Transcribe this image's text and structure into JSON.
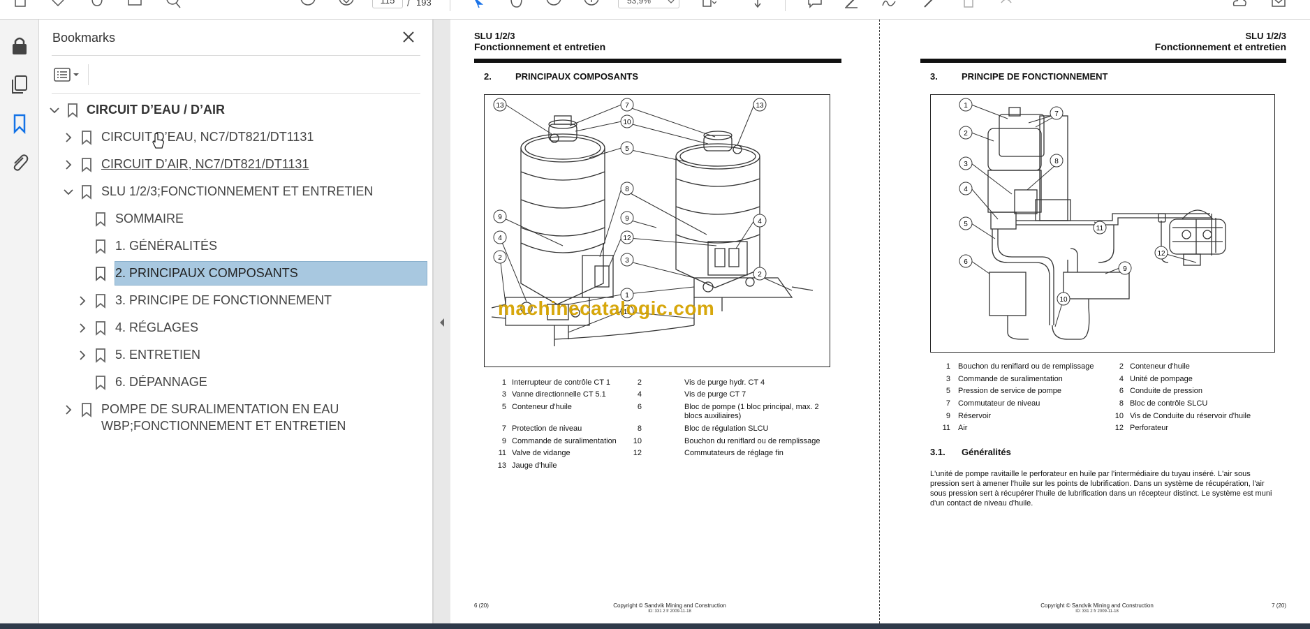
{
  "toolbar": {
    "page_current": "115",
    "page_separator": "/",
    "page_total": "193",
    "zoom": "53,9%",
    "icons": [
      "save-icon",
      "star-icon",
      "upload-icon",
      "print-icon",
      "search-icon",
      "page-up-icon",
      "page-down-icon",
      "select-arrow-icon",
      "hand-icon",
      "zoom-out-icon",
      "zoom-in-icon",
      "zoom-dropdown-icon",
      "fit-page-icon",
      "scroll-icon",
      "comment-icon",
      "highlight-icon",
      "sign-icon",
      "edit-icon",
      "delete-icon",
      "undo-icon",
      "cloud-icon",
      "mail-icon"
    ]
  },
  "rail": {
    "icons": [
      "lock-icon",
      "pages-icon",
      "bookmark-icon",
      "attachment-icon"
    ]
  },
  "bookmarks": {
    "title": "Bookmarks",
    "items": [
      {
        "label": "CIRCUIT D’EAU / D’AIR",
        "level": 0,
        "expanded": true
      },
      {
        "label": "CIRCUIT D’EAU, NC7/DT821/DT1131",
        "level": 1,
        "expanded": false
      },
      {
        "label": "CIRCUIT D’AIR, NC7/DT821/DT1131",
        "level": 1,
        "expanded": false
      },
      {
        "label": "SLU 1/2/3;FONCTIONNEMENT ET ENTRETIEN",
        "level": 1,
        "expanded": true
      },
      {
        "label": "SOMMAIRE",
        "level": 2
      },
      {
        "label": "1. GÉNÉRALITÉS",
        "level": 2
      },
      {
        "label": "2. PRINCIPAUX COMPOSANTS",
        "level": 2,
        "selected": true
      },
      {
        "label": "3. PRINCIPE DE FONCTIONNEMENT",
        "level": 2,
        "expanded": false
      },
      {
        "label": "4. RÉGLAGES",
        "level": 2,
        "expanded": false
      },
      {
        "label": "5. ENTRETIEN",
        "level": 2,
        "expanded": false
      },
      {
        "label": "6. DÉPANNAGE",
        "level": 2
      },
      {
        "label_line1": "POMPE DE SURALIMENTATION EN EAU",
        "label_line2": "WBP;FONCTIONNEMENT ET ENTRETIEN",
        "level": 1,
        "expanded": false
      }
    ]
  },
  "doc": {
    "left": {
      "code": "SLU 1/2/3",
      "title": "Fonctionnement et entretien",
      "section_num": "2.",
      "section_title": "PRINCIPAUX COMPOSANTS",
      "callouts": [
        "13",
        "7",
        "13",
        "10",
        "10",
        "5",
        "8",
        "9",
        "9",
        "4",
        "4",
        "12",
        "2",
        "3",
        "1",
        "2",
        "11"
      ],
      "legend": [
        {
          "n": "1",
          "t": "Interrupteur de contrôle CT 1"
        },
        {
          "n": "2",
          "t": "Vis de purge hydr. CT 4"
        },
        {
          "n": "3",
          "t": "Vanne directionnelle CT 5.1"
        },
        {
          "n": "4",
          "t": "Vis de purge CT 7"
        },
        {
          "n": "5",
          "t": "Conteneur d'huile"
        },
        {
          "n": "6",
          "t": "Bloc de pompe (1 bloc principal, max. 2",
          "t2": "blocs auxiliaires)"
        },
        {
          "n": "7",
          "t": "Protection de niveau"
        },
        {
          "n": "8",
          "t": "Bloc de régulation SLCU"
        },
        {
          "n": "9",
          "t": "Commande de suralimentation"
        },
        {
          "n": "10",
          "t": "Bouchon du reniflard ou de remplissage"
        },
        {
          "n": "11",
          "t": "Valve de vidange"
        },
        {
          "n": "12",
          "t": "Commutateurs de réglage fin"
        },
        {
          "n": "13",
          "t": "Jauge d'huile"
        }
      ],
      "footer_page": "6 (20)",
      "footer_copyright": "Copyright © Sandvik Mining and Construction",
      "footer_id": "ID: 331 2 fr 2009-11-18",
      "watermark": "machinecatalogic.com"
    },
    "right": {
      "code": "SLU 1/2/3",
      "title": "Fonctionnement et entretien",
      "section_num": "3.",
      "section_title": "PRINCIPE DE FONCTIONNEMENT",
      "callouts": [
        "1",
        "7",
        "2",
        "8",
        "3",
        "4",
        "5",
        "11",
        "6",
        "9",
        "10",
        "12"
      ],
      "legend": [
        {
          "n": "1",
          "t": "Bouchon du reniflard ou de remplissage"
        },
        {
          "n": "2",
          "t": "Conteneur d'huile"
        },
        {
          "n": "3",
          "t": "Commande de suralimentation"
        },
        {
          "n": "4",
          "t": "Unité de pompage"
        },
        {
          "n": "5",
          "t": "Pression de service de pompe"
        },
        {
          "n": "6",
          "t": "Conduite de pression"
        },
        {
          "n": "7",
          "t": "Commutateur de niveau"
        },
        {
          "n": "8",
          "t": "Bloc de contrôle SLCU"
        },
        {
          "n": "9",
          "t": "Réservoir"
        },
        {
          "n": "10",
          "t": "Vis de Conduite du réservoir d'huile"
        },
        {
          "n": "11",
          "t": "Air"
        },
        {
          "n": "12",
          "t": "Perforateur"
        }
      ],
      "subsection_num": "3.1.",
      "subsection_title": "Généralités",
      "paragraph": "L'unité de pompe ravitaille le perforateur en huile par l'intermédiaire du tuyau inséré. L'air sous pression sert à amener l'huile sur les points de lubrification. Dans un système de récupération, l'air sous pression sert à récupérer l'huile de lubrification dans un récepteur distinct. Le système est muni d'un contact de niveau d'huile.",
      "footer_page": "7 (20)",
      "footer_copyright": "Copyright © Sandvik Mining and Construction",
      "footer_id": "ID: 331 2 fr 2009-11-18"
    }
  }
}
